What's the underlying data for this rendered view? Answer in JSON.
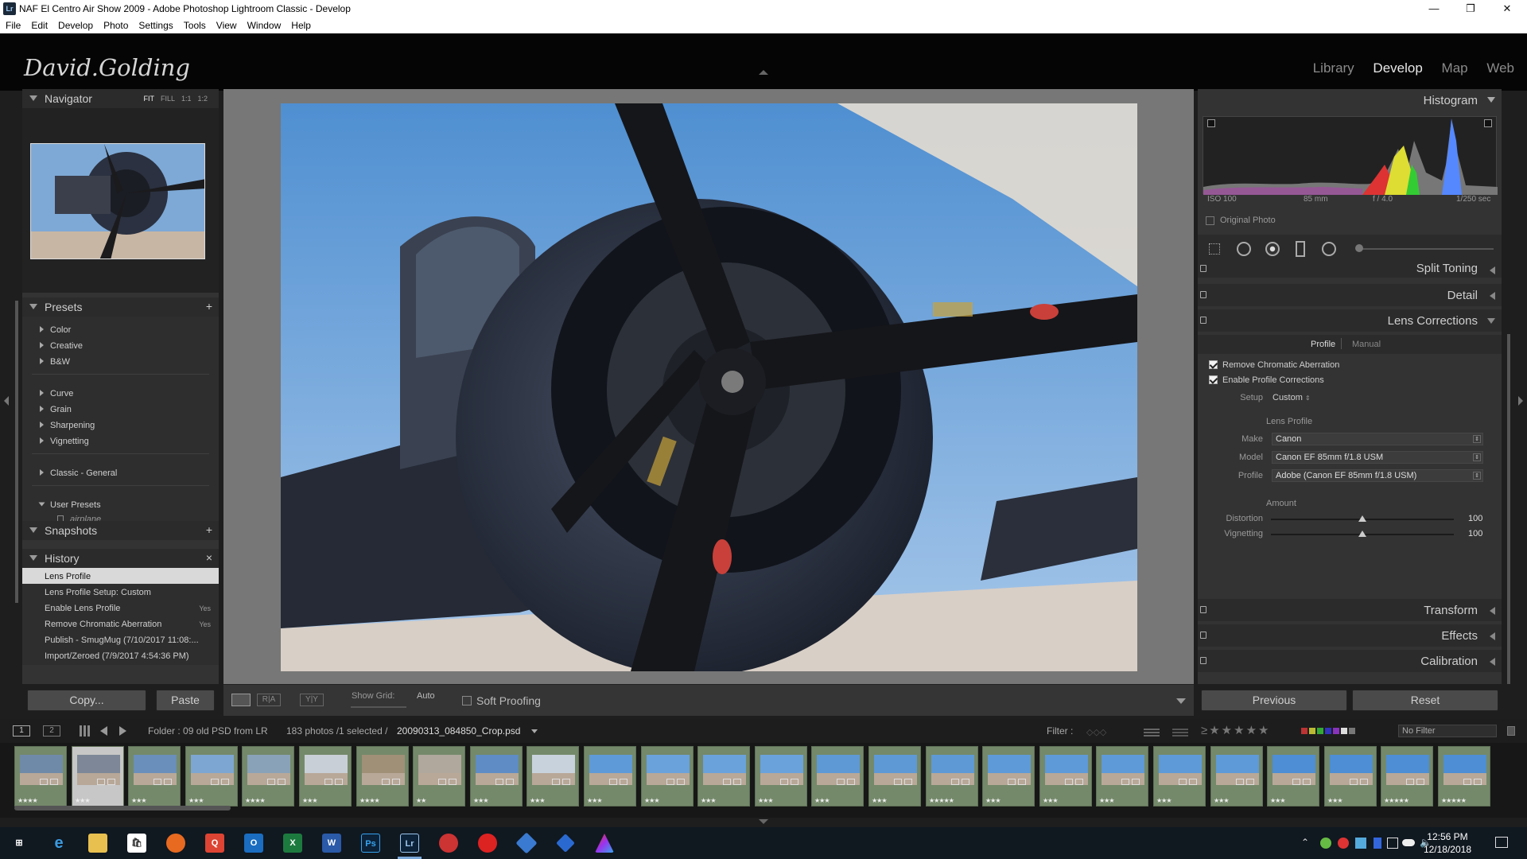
{
  "window": {
    "title": "NAF El Centro Air Show 2009 - Adobe Photoshop Lightroom Classic - Develop",
    "icon": "Lr"
  },
  "menu": [
    "File",
    "Edit",
    "Develop",
    "Photo",
    "Settings",
    "Tools",
    "View",
    "Window",
    "Help"
  ],
  "identity_plate": "David.Golding",
  "modules": [
    "Library",
    "Develop",
    "Map",
    "Web"
  ],
  "active_module": "Develop",
  "navigator": {
    "title": "Navigator",
    "modes": [
      "FIT",
      "FILL",
      "1:1",
      "1:2"
    ]
  },
  "presets": {
    "title": "Presets",
    "add": "+",
    "groups": [
      "Color",
      "Creative",
      "B&W",
      "Curve",
      "Grain",
      "Sharpening",
      "Vignetting",
      "Classic - General",
      "User Presets"
    ],
    "user_preset": "airplane"
  },
  "snapshots": {
    "title": "Snapshots",
    "add": "+"
  },
  "history": {
    "title": "History",
    "clear": "×",
    "items": [
      {
        "label": "Lens Profile",
        "value": ""
      },
      {
        "label": "Lens Profile Setup: Custom",
        "value": ""
      },
      {
        "label": "Enable Lens Profile",
        "value": "Yes"
      },
      {
        "label": "Remove Chromatic Aberration",
        "value": "Yes"
      },
      {
        "label": "Publish - SmugMug (7/10/2017 11:08:...",
        "value": ""
      },
      {
        "label": "Import/Zeroed (7/9/2017 4:54:36 PM)",
        "value": ""
      }
    ]
  },
  "left_buttons": {
    "copy": "Copy...",
    "paste": "Paste"
  },
  "toolbar": {
    "show_grid_label": "Show Grid:",
    "show_grid_value": "Auto",
    "soft_proofing": "Soft Proofing"
  },
  "histogram": {
    "title": "Histogram",
    "iso": "ISO 100",
    "focal": "85 mm",
    "aperture": "f / 4.0",
    "shutter": "1/250 sec",
    "original_photo": "Original Photo"
  },
  "right_panels": {
    "split_toning": "Split Toning",
    "detail": "Detail",
    "lens_corrections": "Lens Corrections",
    "transform": "Transform",
    "effects": "Effects",
    "calibration": "Calibration"
  },
  "lens": {
    "tabs": [
      "Profile",
      "Manual"
    ],
    "remove_ca": "Remove Chromatic Aberration",
    "enable_profile": "Enable Profile Corrections",
    "setup_label": "Setup",
    "setup_value": "Custom",
    "lens_profile": "Lens Profile",
    "make_label": "Make",
    "make_value": "Canon",
    "model_label": "Model",
    "model_value": "Canon EF 85mm f/1.8 USM",
    "profile_label": "Profile",
    "profile_value": "Adobe (Canon EF 85mm f/1.8 USM)",
    "amount": "Amount",
    "distortion_label": "Distortion",
    "distortion_value": "100",
    "vignetting_label": "Vignetting",
    "vignetting_value": "100"
  },
  "right_buttons": {
    "previous": "Previous",
    "reset": "Reset"
  },
  "filmbar": {
    "page1": "1",
    "page2": "2",
    "folder": "Folder : 09 old PSD from LR",
    "count": "183 photos /1 selected /",
    "file": "20090313_084850_Crop.psd",
    "filter_label": "Filter :",
    "filter_value": "No Filter"
  },
  "thumbnails": [
    {
      "stars": "★★★★",
      "sky": "#6f8aa8"
    },
    {
      "stars": "★★★",
      "sky": "#7d8797"
    },
    {
      "stars": "★★★",
      "sky": "#6a8fba"
    },
    {
      "stars": "★★★",
      "sky": "#7ea6d2"
    },
    {
      "stars": "★★★★",
      "sky": "#8aa2b8"
    },
    {
      "stars": "★★★",
      "sky": "#c9cfd6"
    },
    {
      "stars": "★★★★",
      "sky": "#a09078"
    },
    {
      "stars": "★★",
      "sky": "#b0a89c"
    },
    {
      "stars": "★★★",
      "sky": "#5f8cc4"
    },
    {
      "stars": "★★★",
      "sky": "#c8d2dc"
    },
    {
      "stars": "★★★",
      "sky": "#5f9ad8"
    },
    {
      "stars": "★★★",
      "sky": "#6aa2dc"
    },
    {
      "stars": "★★★",
      "sky": "#6aa2dc"
    },
    {
      "stars": "★★★",
      "sky": "#6aa2dc"
    },
    {
      "stars": "★★★",
      "sky": "#5e99d6"
    },
    {
      "stars": "★★★",
      "sky": "#5e99d6"
    },
    {
      "stars": "★★★★★",
      "sky": "#5e99d6"
    },
    {
      "stars": "★★★",
      "sky": "#5e9ad8"
    },
    {
      "stars": "★★★",
      "sky": "#5e9ad8"
    },
    {
      "stars": "★★★",
      "sky": "#5e9ad8"
    },
    {
      "stars": "★★★",
      "sky": "#5e9ad8"
    },
    {
      "stars": "★★★",
      "sky": "#5e9ad8"
    },
    {
      "stars": "★★★",
      "sky": "#4d8ed4"
    },
    {
      "stars": "★★★",
      "sky": "#4d8ed4"
    },
    {
      "stars": "★★★★★",
      "sky": "#4d8ed4"
    },
    {
      "stars": "★★★★★",
      "sky": "#4d8ed4"
    }
  ],
  "clock": {
    "time": "12:56 PM",
    "date": "12/18/2018"
  },
  "taskbar_apps": [
    "windows-start",
    "edge",
    "file-explorer",
    "store",
    "firefox",
    "qq-app",
    "outlook",
    "excel",
    "word",
    "photoshop",
    "lightroom",
    "chrome-like",
    "creative-cloud",
    "app-stack",
    "app-cube",
    "affinity"
  ]
}
